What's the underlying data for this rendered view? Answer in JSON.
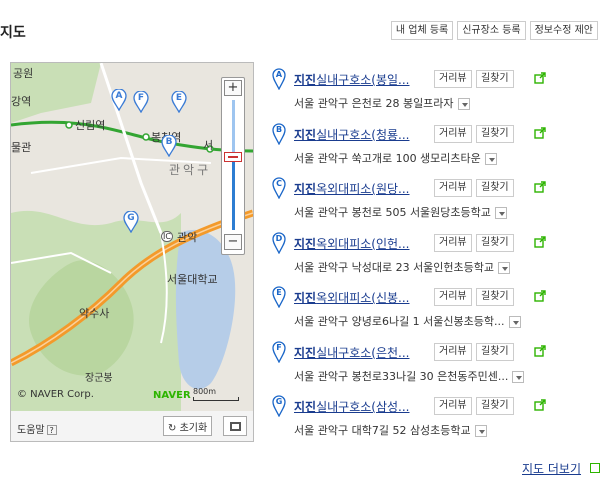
{
  "page": {
    "title": "지도"
  },
  "top_buttons": [
    "내 업체 등록",
    "신규장소 등록",
    "정보수정 제안"
  ],
  "map": {
    "labels": {
      "park": "공원",
      "sillim_station": "신림역",
      "bongcheon_station": "봉천역",
      "seoul_partial": "서",
      "gwanak_gu": "관악구",
      "gwanak_ic": "관악",
      "snu": "서울대학교",
      "yaksusa": "약수사",
      "janggunbong": "장군봉",
      "left_partial_1": "강역",
      "left_partial_2": "물관"
    },
    "ic_badge": "IC",
    "markers": [
      "A",
      "F",
      "E",
      "B",
      "G"
    ],
    "copyright": "© NAVER Corp.",
    "naver_logo": "NAVER",
    "scale": "800m",
    "help": "도움말",
    "help_q": "?",
    "reset": "초기화",
    "zoom_in": "+",
    "zoom_out": "−",
    "zoom_level_fraction": 0.55
  },
  "results": [
    {
      "letter": "A",
      "name_bold": "지진",
      "name_rest": "실내구호소(봉일...",
      "road": "거리뷰",
      "directions": "길찾기",
      "address": "서울 관악구 은천로 28 봉일프라자"
    },
    {
      "letter": "B",
      "name_bold": "지진",
      "name_rest": "실내구호소(청룡...",
      "road": "거리뷰",
      "directions": "길찾기",
      "address": "서울 관악구 쑥고개로 100 생모리츠타운"
    },
    {
      "letter": "C",
      "name_bold": "지진",
      "name_rest": "옥외대피소(원당...",
      "road": "거리뷰",
      "directions": "길찾기",
      "address": "서울 관악구 봉천로 505 서울원당초등학교"
    },
    {
      "letter": "D",
      "name_bold": "지진",
      "name_rest": "옥외대피소(인헌...",
      "road": "거리뷰",
      "directions": "길찾기",
      "address": "서울 관악구 낙성대로 23 서울인헌초등학교"
    },
    {
      "letter": "E",
      "name_bold": "지진",
      "name_rest": "옥외대피소(신봉...",
      "road": "거리뷰",
      "directions": "길찾기",
      "address": "서울 관악구 양녕로6나길 1 서울신봉초등학..."
    },
    {
      "letter": "F",
      "name_bold": "지진",
      "name_rest": "실내구호소(은천...",
      "road": "거리뷰",
      "directions": "길찾기",
      "address": "서울 관악구 봉천로33나길 30 은천동주민센..."
    },
    {
      "letter": "G",
      "name_bold": "지진",
      "name_rest": "실내구호소(삼성...",
      "road": "거리뷰",
      "directions": "길찾기",
      "address": "서울 관악구 대학7길 52 삼성초등학교"
    }
  ],
  "more_link": "지도 더보기",
  "colors": {
    "link": "#1a3c8f",
    "pin": "#1a66c8",
    "road_orange": "#f39a2b",
    "subway_green": "#33a532",
    "water": "#b6cde8",
    "green_area": "#c9dfb6"
  }
}
